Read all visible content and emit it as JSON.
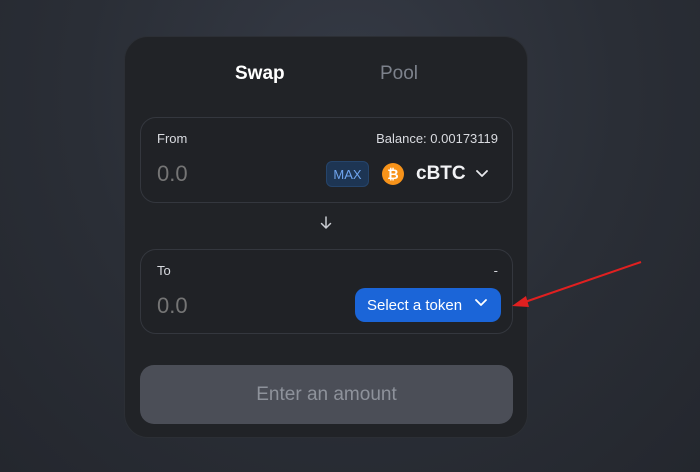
{
  "tabs": {
    "swap_label": "Swap",
    "pool_label": "Pool"
  },
  "from": {
    "label": "From",
    "balance": "Balance: 0.00173119",
    "amount_placeholder": "0.0",
    "max_label": "MAX",
    "token": {
      "symbol": "cBTC",
      "icon": "bitcoin-icon",
      "icon_glyph": "₿"
    }
  },
  "switch_icon": "arrow-down-icon",
  "to": {
    "label": "To",
    "balance": "-",
    "amount_placeholder": "0.0",
    "select_label": "Select a token"
  },
  "submit": {
    "label": "Enter an amount"
  },
  "colors": {
    "accent": "#1b65d8",
    "annotation": "#e02020",
    "btc": "#f7931a"
  }
}
